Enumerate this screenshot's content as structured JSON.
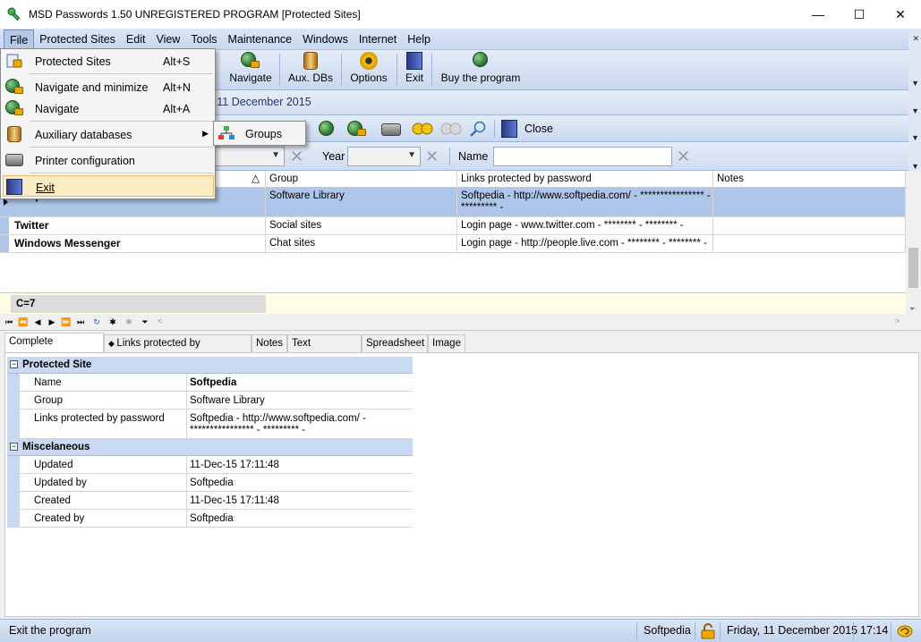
{
  "window": {
    "title": "MSD Passwords 1.50 UNREGISTERED PROGRAM [Protected Sites]",
    "minimize": "—",
    "maximize": "☐",
    "close": "✕"
  },
  "menu": [
    "File",
    "Protected Sites",
    "Edit",
    "View",
    "Tools",
    "Maintenance",
    "Windows",
    "Internet",
    "Help"
  ],
  "toolbar": {
    "navigate": "Navigate",
    "aux_dbs": "Aux. DBs",
    "options": "Options",
    "exit": "Exit",
    "buy": "Buy the program"
  },
  "date_banner": "y, 11 December 2015",
  "toolbar2": {
    "close": "Close"
  },
  "filters": {
    "year_label": "Year",
    "name_label": "Name",
    "name_value": ""
  },
  "grid": {
    "columns": [
      "Group",
      "Links protected by password",
      "Notes"
    ],
    "rows": [
      {
        "name": "Softpedia",
        "group": "Software Library",
        "links": "Softpedia - http://www.softpedia.com/ - **************** - ********* -",
        "notes": ""
      },
      {
        "name": "Twitter",
        "group": "Social sites",
        "links": "Login page - www.twitter.com - ******** - ******** -",
        "notes": ""
      },
      {
        "name": "Windows Messenger",
        "group": "Chat sites",
        "links": "Login page - http://people.live.com - ******** - ******** -",
        "notes": ""
      }
    ],
    "count": "C=7"
  },
  "tabs": [
    "Complete information",
    "Links protected by password",
    "Notes",
    "Text document",
    "Spreadsheet",
    "Image"
  ],
  "details": {
    "cat1": "Protected Site",
    "name_k": "Name",
    "name_v": "Softpedia",
    "group_k": "Group",
    "group_v": "Software Library",
    "links_k": "Links protected by password",
    "links_v": "Softpedia - http://www.softpedia.com/ - **************** - ********* -",
    "cat2": "Miscelaneous",
    "updated_k": "Updated",
    "updated_v": "11-Dec-15 17:11:48",
    "updatedby_k": "Updated by",
    "updatedby_v": "Softpedia",
    "created_k": "Created",
    "created_v": "11-Dec-15 17:11:48",
    "createdby_k": "Created by",
    "createdby_v": "Softpedia"
  },
  "status": {
    "message": "Exit the program",
    "user": "Softpedia",
    "date": "Friday, 11 December 2015",
    "time": "17:14"
  },
  "file_menu": {
    "protected_sites": "Protected Sites",
    "protected_sites_key": "Alt+S",
    "nav_min": "Navigate and minimize",
    "nav_min_key": "Alt+N",
    "navigate": "Navigate",
    "navigate_key": "Alt+A",
    "aux": "Auxiliary databases",
    "printer": "Printer configuration",
    "exit": "Exit"
  },
  "submenu": {
    "groups": "Groups"
  }
}
